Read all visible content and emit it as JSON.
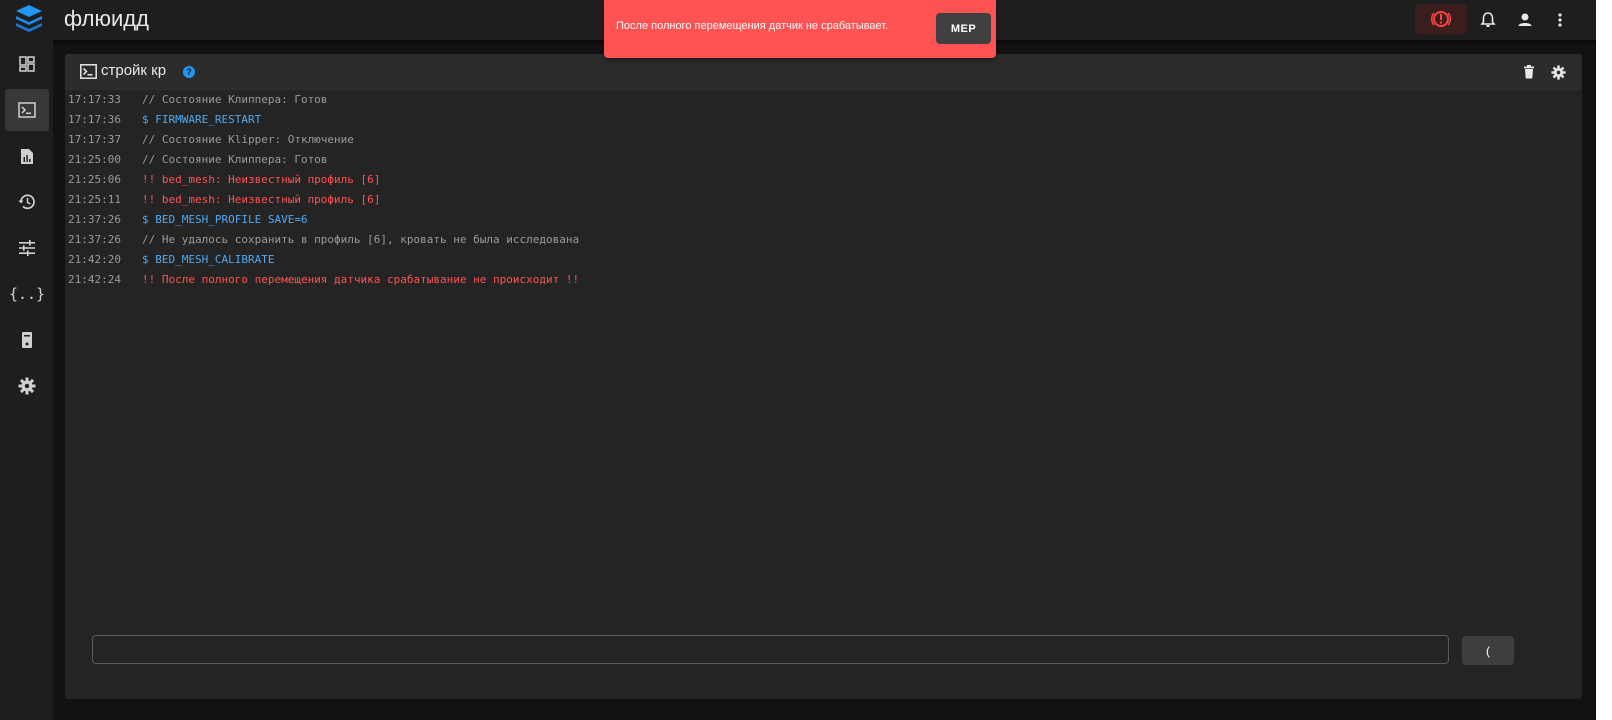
{
  "app": {
    "title": "флюидд"
  },
  "snackbar": {
    "message": "После полного перемещения датчик не срабатывает.",
    "action_label": "МЕР",
    "color": "#ff5252"
  },
  "topbar": {
    "icons": [
      "emergency-stop-icon",
      "bell-icon",
      "account-icon",
      "more-vert-icon"
    ]
  },
  "sidebar": {
    "items": [
      {
        "icon": "dashboard-icon",
        "active": false
      },
      {
        "icon": "console-icon",
        "active": true
      },
      {
        "icon": "files-icon",
        "active": false
      },
      {
        "icon": "history-icon",
        "active": false
      },
      {
        "icon": "tune-icon",
        "active": false
      },
      {
        "icon": "macros-icon",
        "active": false
      },
      {
        "icon": "system-icon",
        "active": false
      },
      {
        "icon": "settings-icon",
        "active": false
      }
    ]
  },
  "console": {
    "title": "стройк кр",
    "lines": [
      {
        "time": "17:17:33",
        "type": "comment",
        "text": "// Состояние Клиппера: Готов"
      },
      {
        "time": "17:17:36",
        "type": "cmd",
        "text": "$ FIRMWARE_RESTART"
      },
      {
        "time": "17:17:37",
        "type": "comment",
        "text": "// Состояние Klipper: Отключение"
      },
      {
        "time": "21:25:00",
        "type": "comment",
        "text": "// Состояние Клиппера: Готов"
      },
      {
        "time": "21:25:06",
        "type": "error",
        "text": "!! bed_mesh: Неизвестный профиль [6]"
      },
      {
        "time": "21:25:11",
        "type": "error",
        "text": "!! bed_mesh: Неизвестный профиль [6]"
      },
      {
        "time": "21:37:26",
        "type": "cmd",
        "text": "$ BED_MESH_PROFILE SAVE=6"
      },
      {
        "time": "21:37:26",
        "type": "comment",
        "text": "// Не удалось сохранить в профиль [6], кровать не была исследована"
      },
      {
        "time": "21:42:20",
        "type": "cmd",
        "text": "$ BED_MESH_CALIBRATE"
      },
      {
        "time": "21:42:24",
        "type": "error",
        "text": "!! После полного перемещения датчика срабатывание не происходит !!"
      }
    ],
    "input_value": "",
    "send_label": "("
  }
}
